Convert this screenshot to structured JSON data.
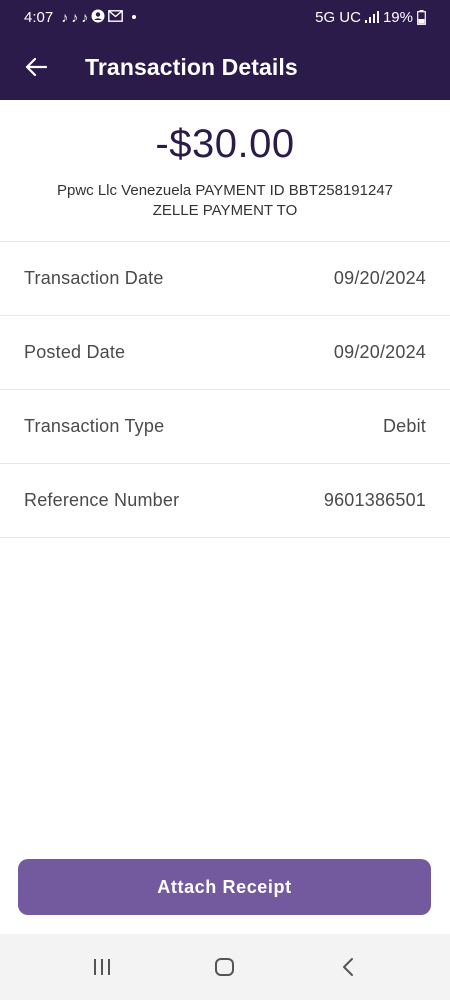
{
  "status_bar": {
    "time": "4:07",
    "network": "5G UC",
    "battery": "19%",
    "notification_icons": [
      "tiktok-icon",
      "tiktok-icon",
      "tiktok-icon",
      "account-icon",
      "gmail-icon"
    ]
  },
  "app_bar": {
    "title": "Transaction Details"
  },
  "transaction": {
    "amount": "-$30.00",
    "description_line1": "Ppwc Llc Venezuela PAYMENT ID BBT258191247",
    "description_line2": "ZELLE PAYMENT TO"
  },
  "details": [
    {
      "label": "Transaction Date",
      "value": "09/20/2024"
    },
    {
      "label": "Posted Date",
      "value": "09/20/2024"
    },
    {
      "label": "Transaction Type",
      "value": "Debit"
    },
    {
      "label": "Reference Number",
      "value": "9601386501"
    }
  ],
  "actions": {
    "attach_receipt_label": "Attach Receipt"
  },
  "colors": {
    "header_bg": "#2a1b4a",
    "button_bg": "#735a9e",
    "amount_text": "#2a1b4a"
  }
}
